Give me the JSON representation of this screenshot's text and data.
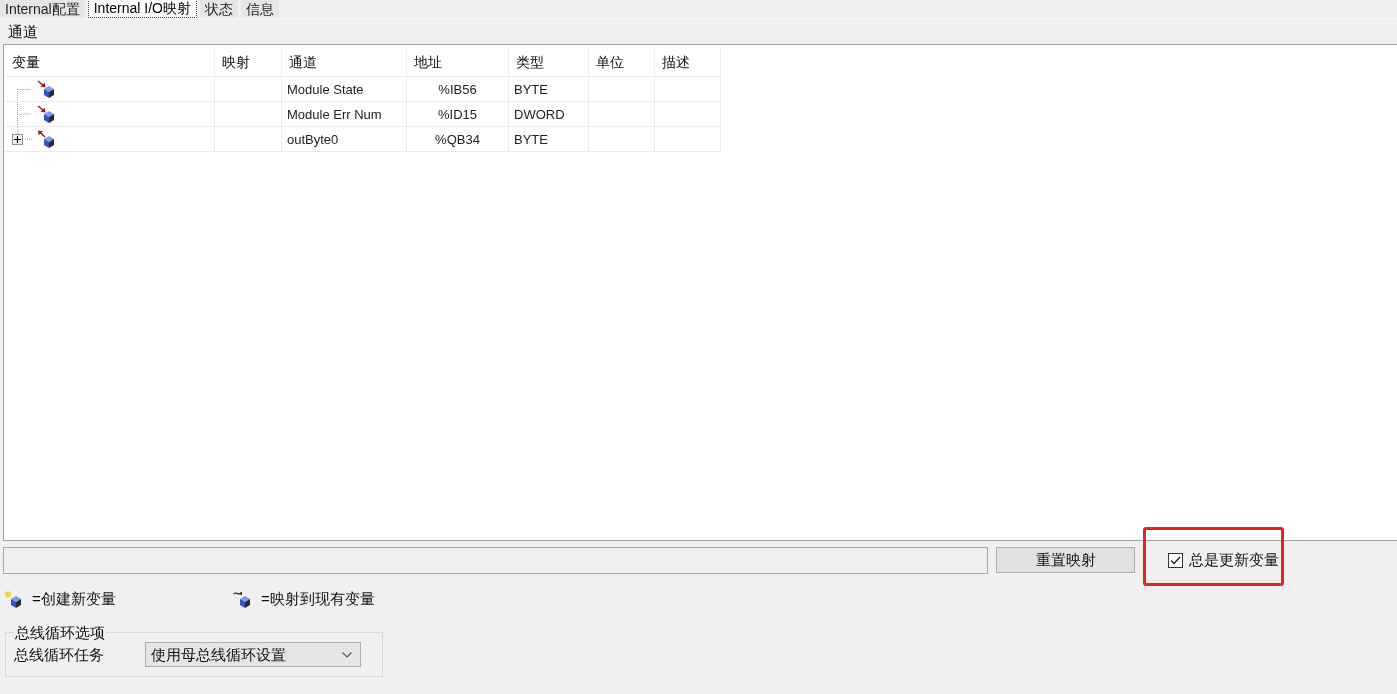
{
  "tabs": [
    {
      "label": "Internal配置",
      "selected": false
    },
    {
      "label": "Internal I/O映射",
      "selected": true
    },
    {
      "label": "状态",
      "selected": false
    },
    {
      "label": "信息",
      "selected": false
    }
  ],
  "section_title": "通道",
  "table": {
    "columns": [
      "变量",
      "映射",
      "通道",
      "地址",
      "类型",
      "单位",
      "描述"
    ],
    "rows": [
      {
        "kind": "input",
        "channel": "Module State",
        "address": "%IB56",
        "type": "BYTE"
      },
      {
        "kind": "input",
        "channel": "Module Err Num",
        "address": "%ID15",
        "type": "DWORD"
      },
      {
        "kind": "output",
        "expanded": false,
        "channel": "outByte0",
        "address": "%QB34",
        "type": "BYTE"
      }
    ]
  },
  "reset_button": "重置映射",
  "always_update": {
    "label": "总是更新变量",
    "checked": true,
    "highlighted": true
  },
  "legend": [
    {
      "kind": "new",
      "text": "=创建新变量"
    },
    {
      "kind": "existing",
      "text": "=映射到现有变量"
    }
  ],
  "bus_cycle": {
    "title": "总线循环选项",
    "label": "总线循环任务",
    "value": "使用母总线循环设置"
  }
}
